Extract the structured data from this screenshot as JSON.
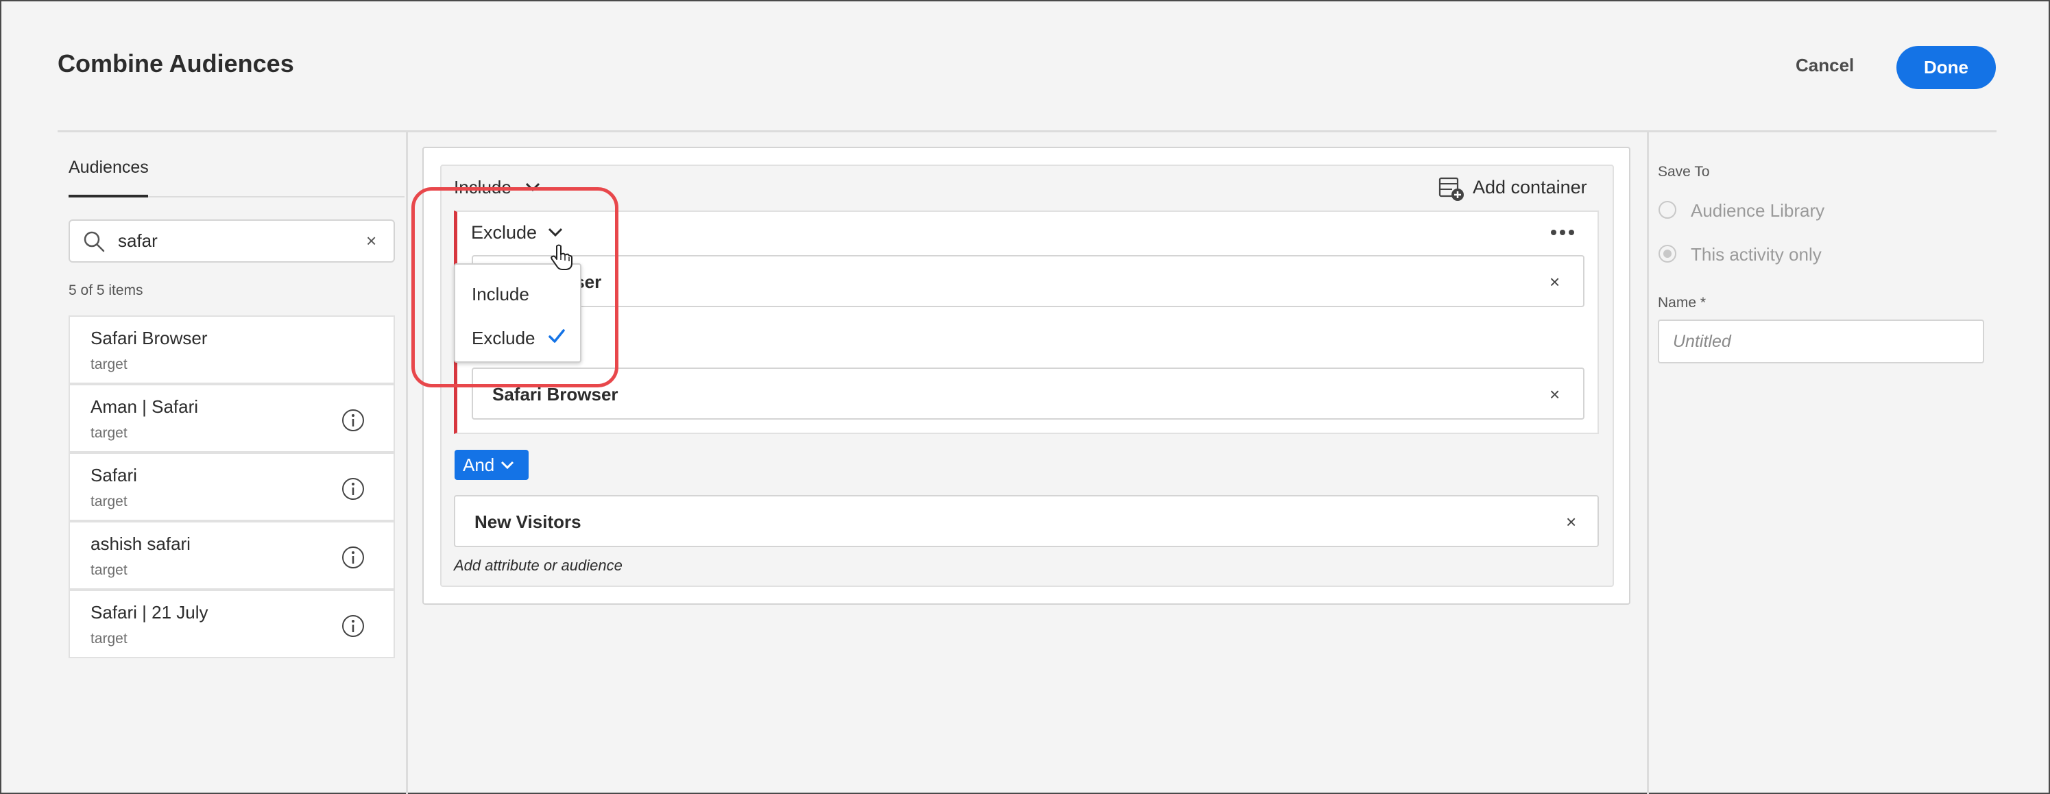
{
  "header": {
    "title": "Combine Audiences",
    "cancel_label": "Cancel",
    "done_label": "Done"
  },
  "left_panel": {
    "tab_label": "Audiences",
    "search": {
      "value": "safar",
      "clear_glyph": "×"
    },
    "count_text": "5 of 5 items",
    "items": [
      {
        "name": "Safari Browser",
        "sub": "target",
        "has_info": false
      },
      {
        "name": "Aman | Safari",
        "sub": "target",
        "has_info": true
      },
      {
        "name": "Safari",
        "sub": "target",
        "has_info": true
      },
      {
        "name": "ashish safari",
        "sub": "target",
        "has_info": true
      },
      {
        "name": "Safari | 21 July",
        "sub": "target",
        "has_info": true
      }
    ]
  },
  "builder": {
    "outer_mode": "Include",
    "add_container_label": "Add container",
    "inner_mode": "Exclude",
    "inner_chips": [
      {
        "label": "Safari Browser",
        "visible_text": "wser"
      },
      {
        "label": "Safari Browser"
      }
    ],
    "and_label": "And",
    "outer_chip": "New Visitors",
    "add_attr_label": "Add attribute or audience",
    "close_glyph": "×",
    "dropdown": {
      "options": [
        "Include",
        "Exclude"
      ],
      "selected": "Exclude"
    }
  },
  "right_panel": {
    "save_to_label": "Save To",
    "options": [
      {
        "label": "Audience Library",
        "checked": false
      },
      {
        "label": "This activity only",
        "checked": true
      }
    ],
    "name_label": "Name *",
    "name_placeholder": "Untitled"
  },
  "colors": {
    "accent": "#1473e6",
    "exclude_bar": "#d7373f",
    "highlight": "#e8474b"
  }
}
